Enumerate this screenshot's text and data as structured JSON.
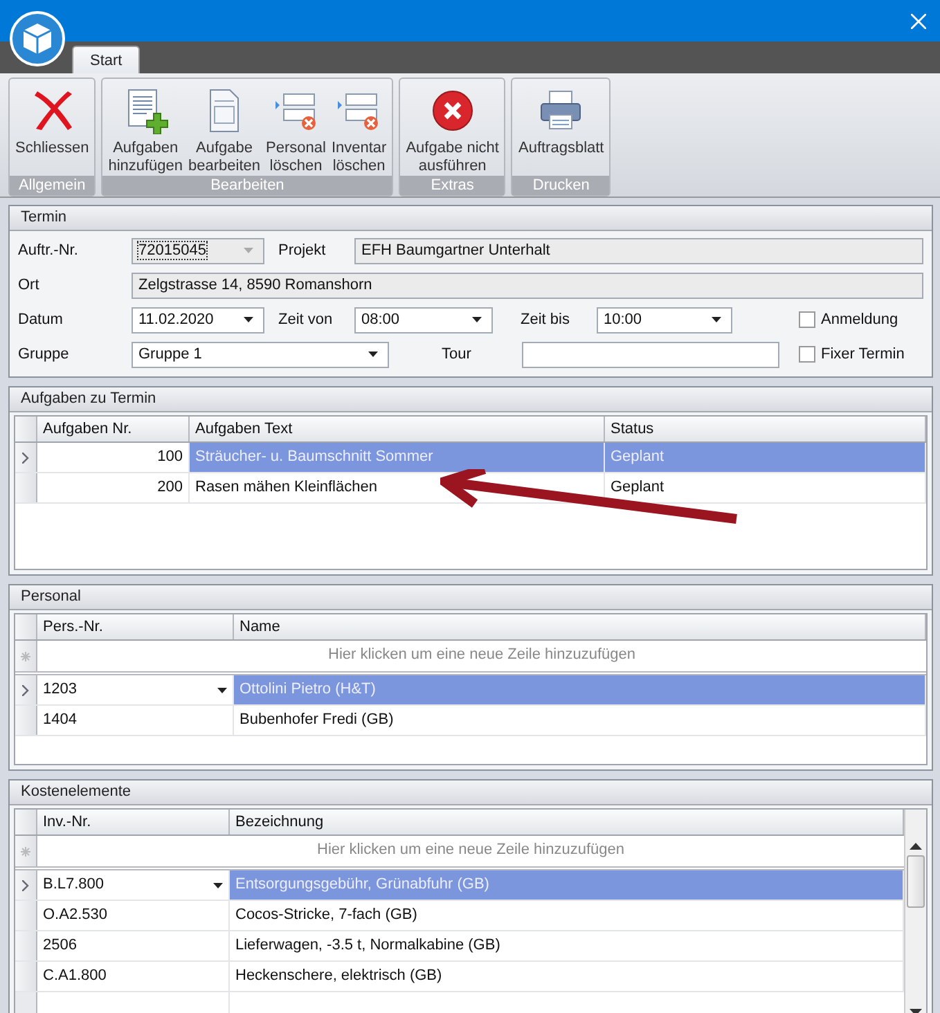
{
  "tabs": [
    {
      "label": "Start",
      "selected": true
    }
  ],
  "ribbon": [
    {
      "label": "Allgemein",
      "buttons": [
        {
          "label": "Schliessen",
          "kind": "close"
        }
      ]
    },
    {
      "label": "Bearbeiten",
      "buttons": [
        {
          "label": "Aufgaben\nhinzufügen",
          "kind": "add-document"
        },
        {
          "label": "Aufgabe\nbearbeiten",
          "kind": "document"
        },
        {
          "label": "Personal\nlöschen",
          "kind": "remove-row"
        },
        {
          "label": "Inventar\nlöschen",
          "kind": "remove-row"
        }
      ]
    },
    {
      "label": "Extras",
      "buttons": [
        {
          "label": "Aufgabe nicht\nausführen",
          "kind": "cancel"
        }
      ]
    },
    {
      "label": "Drucken",
      "buttons": [
        {
          "label": "Auftragsblatt",
          "kind": "printer"
        }
      ]
    }
  ],
  "termin": {
    "title": "Termin",
    "auftr_nr": {
      "label": "Auftr.-Nr.",
      "value": "72015045"
    },
    "projekt": {
      "label": "Projekt",
      "value": "EFH Baumgartner Unterhalt"
    },
    "ort": {
      "label": "Ort",
      "value": "Zelgstrasse 14, 8590 Romanshorn"
    },
    "datum": {
      "label": "Datum",
      "value": "11.02.2020"
    },
    "zeit_von": {
      "label": "Zeit von",
      "value": "08:00"
    },
    "zeit_bis": {
      "label": "Zeit bis",
      "value": "10:00"
    },
    "anmeldung": {
      "label": "Anmeldung",
      "checked": false
    },
    "gruppe": {
      "label": "Gruppe",
      "value": "Gruppe 1"
    },
    "tour": {
      "label": "Tour"
    },
    "fixer_termin": {
      "label": "Fixer Termin",
      "checked": false
    }
  },
  "aufgaben": {
    "title": "Aufgaben zu Termin",
    "columns": [
      "Aufgaben Nr.",
      "Aufgaben Text",
      "Status"
    ],
    "rows": [
      {
        "cells": [
          "100",
          "Sträucher- u. Baumschnitt Sommer",
          "Geplant"
        ],
        "selected": true
      },
      {
        "cells": [
          "200",
          "Rasen mähen Kleinflächen",
          "Geplant"
        ],
        "selected": false
      }
    ]
  },
  "personal": {
    "title": "Personal",
    "columns": [
      "Pers.-Nr.",
      "Name"
    ],
    "new_row_hint": "Hier klicken um eine neue Zeile hinzuzufügen",
    "rows": [
      {
        "cells": [
          "1203",
          "Ottolini Pietro (H&T)"
        ],
        "selected": true
      },
      {
        "cells": [
          "1404",
          "Bubenhofer Fredi (GB)"
        ],
        "selected": false
      }
    ]
  },
  "kosten": {
    "title": "Kostenelemente",
    "columns": [
      "Inv.-Nr.",
      "Bezeichnung"
    ],
    "new_row_hint": "Hier klicken um eine neue Zeile hinzuzufügen",
    "rows": [
      {
        "cells": [
          "B.L7.800",
          "Entsorgungsgebühr, Grünabfuhr (GB)"
        ],
        "selected": true
      },
      {
        "cells": [
          "O.A2.530",
          "Cocos-Stricke, 7-fach (GB)"
        ],
        "selected": false
      },
      {
        "cells": [
          "2506",
          "Lieferwagen, -3.5 t, Normalkabine (GB)"
        ],
        "selected": false
      },
      {
        "cells": [
          "C.A1.800",
          "Heckenschere, elektrisch (GB)"
        ],
        "selected": false
      }
    ]
  }
}
